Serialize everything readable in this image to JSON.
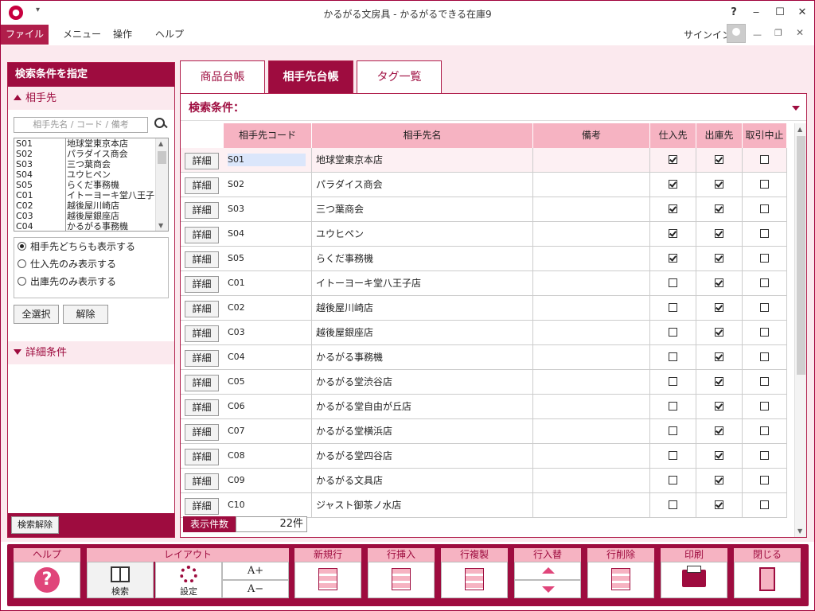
{
  "window": {
    "app_icon": "app-logo-icon",
    "title": "かるがる文房具 - かるがるできる在庫9",
    "help": "?",
    "minimize": "‒",
    "maximize": "☐",
    "close": "✕"
  },
  "menu": {
    "file": "ファイル",
    "menu": "メニュー",
    "ops": "操作",
    "help": "ヘルプ",
    "signin": "サインイン"
  },
  "left_panel": {
    "header": "検索条件を指定",
    "partner_section": "相手先",
    "search_placeholder": "相手先名 / コード / 備考",
    "partners": [
      {
        "code": "S01",
        "name": "地球堂東京本店"
      },
      {
        "code": "S02",
        "name": "パラダイス商会"
      },
      {
        "code": "S03",
        "name": "三つ葉商会"
      },
      {
        "code": "S04",
        "name": "ユウヒペン"
      },
      {
        "code": "S05",
        "name": "らくだ事務機"
      },
      {
        "code": "C01",
        "name": "イトーヨーキ堂八王子"
      },
      {
        "code": "C02",
        "name": "越後屋川崎店"
      },
      {
        "code": "C03",
        "name": "越後屋銀座店"
      },
      {
        "code": "C04",
        "name": "かるがる事務機"
      }
    ],
    "radios": [
      {
        "label": "相手先どちらも表示する",
        "selected": true
      },
      {
        "label": "仕入先のみ表示する",
        "selected": false
      },
      {
        "label": "出庫先のみ表示する",
        "selected": false
      }
    ],
    "select_all": "全選択",
    "release": "解除",
    "detail_section": "詳細条件",
    "clear_search": "検索解除"
  },
  "tabs": [
    {
      "label": "商品台帳",
      "active": false
    },
    {
      "label": "相手先台帳",
      "active": true
    },
    {
      "label": "タグ一覧",
      "active": false
    }
  ],
  "content": {
    "condition_title": "検索条件：",
    "columns": [
      "相手先コード",
      "相手先名",
      "備考",
      "仕入先",
      "出庫先",
      "取引中止"
    ],
    "detail_label": "詳細",
    "rows": [
      {
        "code": "S01",
        "name": "地球堂東京本店",
        "note": "",
        "supplier": true,
        "ship": true,
        "stopped": false
      },
      {
        "code": "S02",
        "name": "パラダイス商会",
        "note": "",
        "supplier": true,
        "ship": true,
        "stopped": false
      },
      {
        "code": "S03",
        "name": "三つ葉商会",
        "note": "",
        "supplier": true,
        "ship": true,
        "stopped": false
      },
      {
        "code": "S04",
        "name": "ユウヒペン",
        "note": "",
        "supplier": true,
        "ship": true,
        "stopped": false
      },
      {
        "code": "S05",
        "name": "らくだ事務機",
        "note": "",
        "supplier": true,
        "ship": true,
        "stopped": false
      },
      {
        "code": "C01",
        "name": "イトーヨーキ堂八王子店",
        "note": "",
        "supplier": false,
        "ship": true,
        "stopped": false
      },
      {
        "code": "C02",
        "name": "越後屋川崎店",
        "note": "",
        "supplier": false,
        "ship": true,
        "stopped": false
      },
      {
        "code": "C03",
        "name": "越後屋銀座店",
        "note": "",
        "supplier": false,
        "ship": true,
        "stopped": false
      },
      {
        "code": "C04",
        "name": "かるがる事務機",
        "note": "",
        "supplier": false,
        "ship": true,
        "stopped": false
      },
      {
        "code": "C05",
        "name": "かるがる堂渋谷店",
        "note": "",
        "supplier": false,
        "ship": true,
        "stopped": false
      },
      {
        "code": "C06",
        "name": "かるがる堂自由が丘店",
        "note": "",
        "supplier": false,
        "ship": true,
        "stopped": false
      },
      {
        "code": "C07",
        "name": "かるがる堂横浜店",
        "note": "",
        "supplier": false,
        "ship": true,
        "stopped": false
      },
      {
        "code": "C08",
        "name": "かるがる堂四谷店",
        "note": "",
        "supplier": false,
        "ship": true,
        "stopped": false
      },
      {
        "code": "C09",
        "name": "かるがる文具店",
        "note": "",
        "supplier": false,
        "ship": true,
        "stopped": false
      },
      {
        "code": "C10",
        "name": "ジャスト御茶ノ水店",
        "note": "",
        "supplier": false,
        "ship": true,
        "stopped": false
      }
    ],
    "count_label": "表示件数",
    "count_value": "22件"
  },
  "toolbar": {
    "help": "ヘルプ",
    "layout": "レイアウト",
    "search": "検索",
    "settings": "設定",
    "font_up": "A+",
    "font_down": "A−",
    "new_row": "新規行",
    "insert_row": "行挿入",
    "copy_row": "行複製",
    "swap_row": "行入替",
    "delete_row": "行削除",
    "print": "印刷",
    "close": "閉じる"
  },
  "colors": {
    "accent": "#9e0c3f",
    "header_pink": "#f6b3c2",
    "background_pink": "#fbe9ee"
  }
}
